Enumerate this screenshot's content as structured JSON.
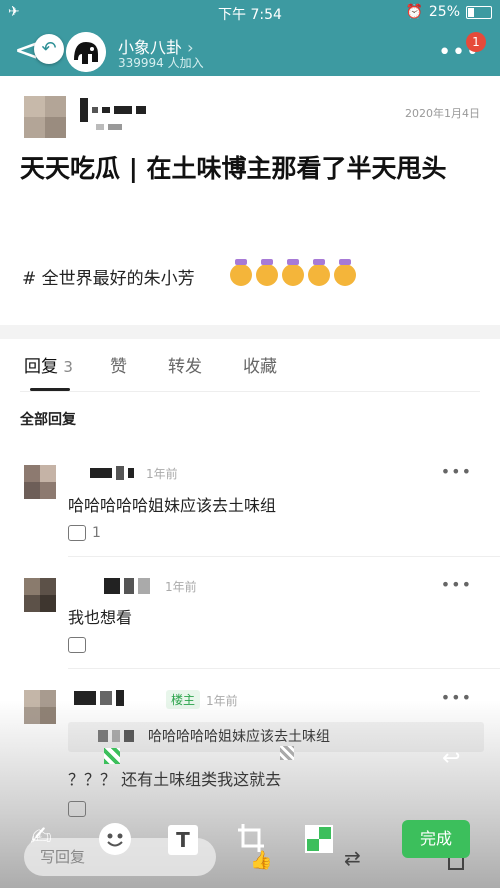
{
  "status_bar": {
    "time": "下午 7:54",
    "battery": "25%",
    "airplane_icon": "airplane-icon",
    "alarm_icon": "alarm-icon"
  },
  "header": {
    "group_name": "小象八卦",
    "chevron": "›",
    "members": "339994 人加入",
    "more": "•••",
    "badge": "1"
  },
  "post": {
    "date": "2020年1月4日",
    "title": "天天吃瓜 | 在土味博主那看了半天甩头",
    "tag": "# 全世界最好的朱小芳"
  },
  "tabs": [
    {
      "label": "回复",
      "count": "3"
    },
    {
      "label": "赞"
    },
    {
      "label": "转发"
    },
    {
      "label": "收藏"
    }
  ],
  "section_title": "全部回复",
  "comments": [
    {
      "time": "1年前",
      "text": "哈哈哈哈哈姐妹应该去土味组",
      "likes": "1"
    },
    {
      "time": "1年前",
      "text": "我也想看",
      "likes": ""
    },
    {
      "host_badge": "楼主",
      "time": "1年前",
      "quote": "哈哈哈哈哈姐妹应该去土味组",
      "text": "？？？ 还有土味组类我这就去",
      "likes": ""
    }
  ],
  "editor": {
    "reply_placeholder": "写回复",
    "done_label": "完成",
    "tools": [
      "pen-icon",
      "sticker-icon",
      "text-icon",
      "crop-icon",
      "mosaic-icon"
    ],
    "text_tool_glyph": "T"
  },
  "colors": {
    "header_bg": "#3d9aa1",
    "badge": "#e64a3a",
    "done": "#3cbf5c",
    "host": "#2aa34a"
  }
}
